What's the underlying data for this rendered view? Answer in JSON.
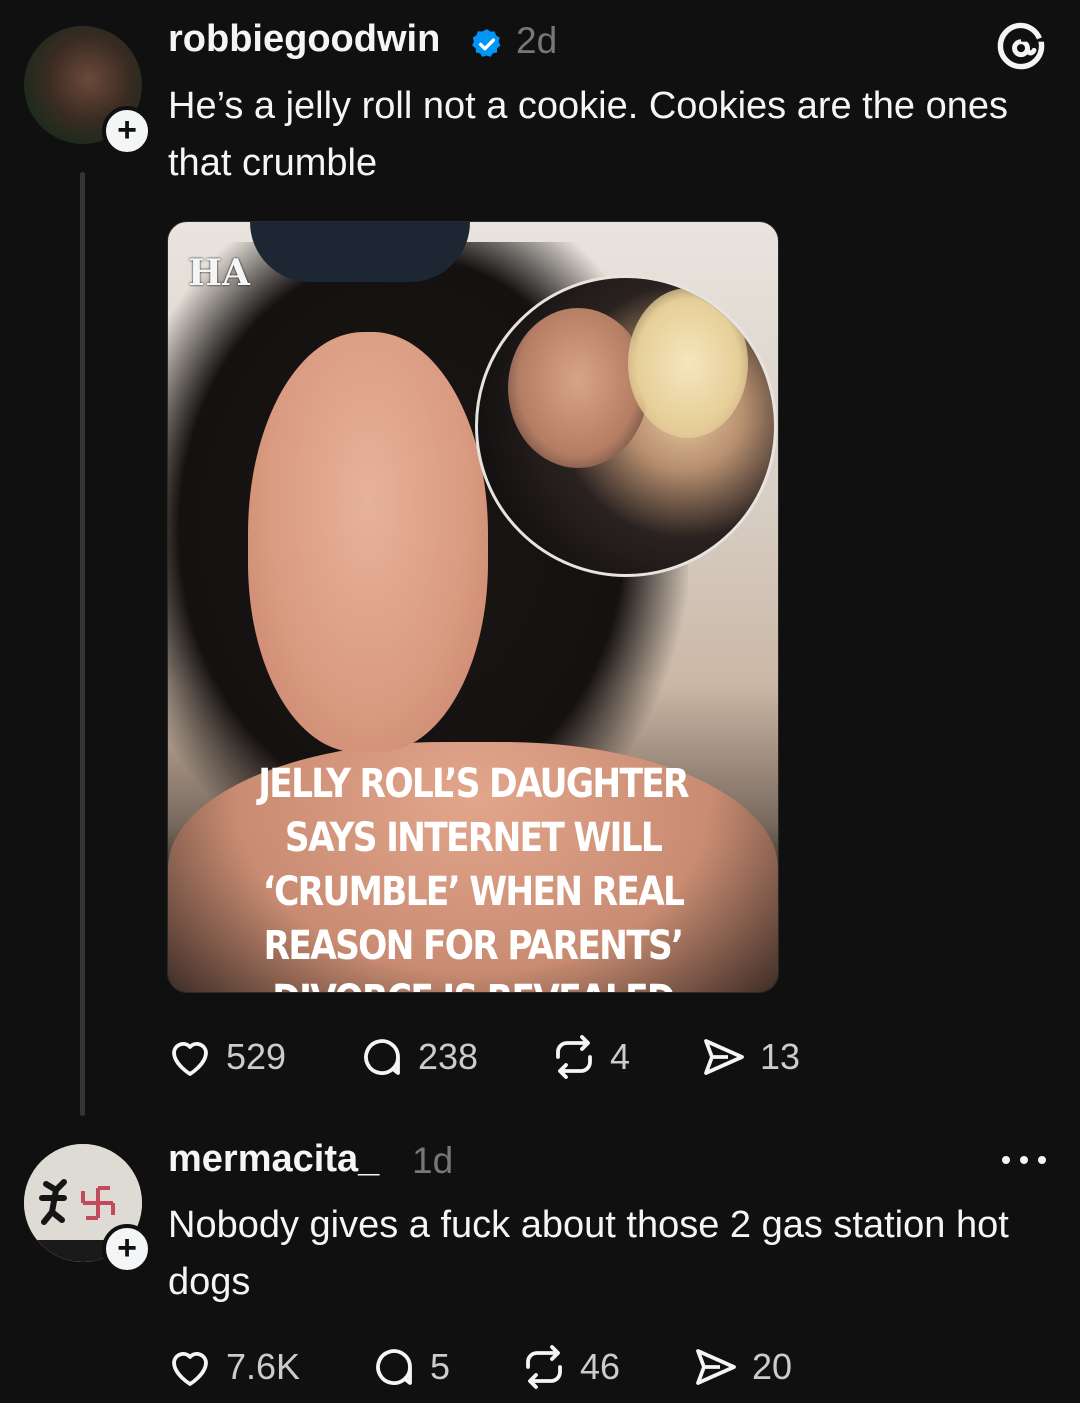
{
  "posts": [
    {
      "username": "robbiegoodwin",
      "time": "2d",
      "text": "He’s a jelly roll not a cookie. Cookies are the ones that crumble",
      "media": {
        "logo": "HA",
        "headline": "JELLY ROLL’S DAUGHTER SAYS INTERNET WILL ‘CRUMBLE’ WHEN REAL REASON FOR PARENTS’ DIVORCE IS REVEALED"
      },
      "likes": "529",
      "comments": "238",
      "reposts": "4",
      "shares": "13"
    },
    {
      "username": "mermacita_",
      "time": "1d",
      "text": "Nobody gives a fuck about those 2 gas station hot dogs",
      "likes": "7.6K",
      "comments": "5",
      "reposts": "46",
      "shares": "20"
    }
  ],
  "icons": {
    "verified": "verified-badge-icon",
    "threads": "threads-logo-icon",
    "like": "heart-icon",
    "comment": "comment-bubble-icon",
    "repost": "repost-icon",
    "share": "send-icon",
    "more": "more-dots-icon",
    "follow": "plus-icon"
  },
  "colors": {
    "background": "#101010",
    "text": "#f3f5f7",
    "muted": "#777777",
    "verified": "#0095f6"
  }
}
